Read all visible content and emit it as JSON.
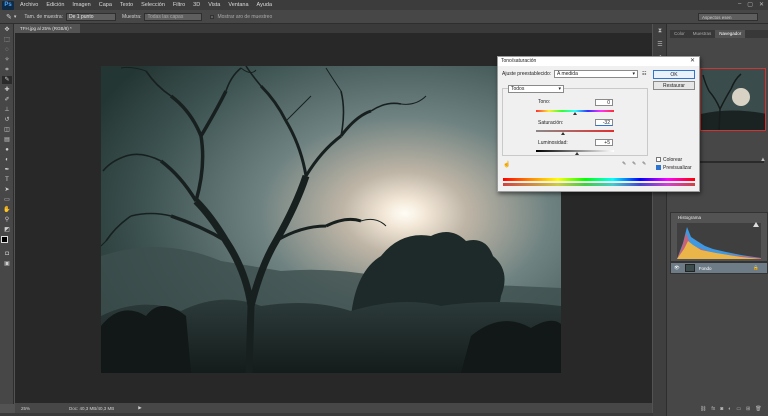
{
  "app": {
    "logo": "Ps"
  },
  "menu": [
    "Archivo",
    "Edición",
    "Imagen",
    "Capa",
    "Texto",
    "Selección",
    "Filtro",
    "3D",
    "Vista",
    "Ventana",
    "Ayuda"
  ],
  "window_controls": [
    "–",
    "▢",
    "✕"
  ],
  "options": {
    "sample_label": "Tam. de muestra:",
    "sample_value": "De 1 punto",
    "samples_label": "Muestra:",
    "samples_value": "Todas las capas",
    "ring_label": "Mostrar aro de muestreo",
    "workspace": "Aspectos esen"
  },
  "document": {
    "tab_title": "TFH.jpg al 25% (RGB/8) *"
  },
  "status": {
    "zoom": "25%",
    "doc_info": "Doc: 40,3 MB/40,3 MB"
  },
  "panels": {
    "tabs": [
      "Color",
      "Muestras",
      "Navegador"
    ],
    "active_tab": "Navegador",
    "histogram_tab": "Histograma",
    "layer_name": "Fondo"
  },
  "dialog": {
    "title": "Tono/saturación",
    "preset_label": "Ajuste preestablecido:",
    "preset_value": "A medida",
    "ok": "OK",
    "reset": "Restaurar",
    "channel": "Todos",
    "hue_label": "Tono:",
    "hue_value": "0",
    "saturation_label": "Saturación:",
    "saturation_value": "-32",
    "lightness_label": "Luminosidad:",
    "lightness_value": "+5",
    "colorize_label": "Colorear",
    "preview_label": "Previsualizar",
    "colorize_checked": false,
    "preview_checked": true,
    "hue_fraction": 0.5,
    "saturation_fraction": 0.34,
    "lightness_fraction": 0.525
  }
}
